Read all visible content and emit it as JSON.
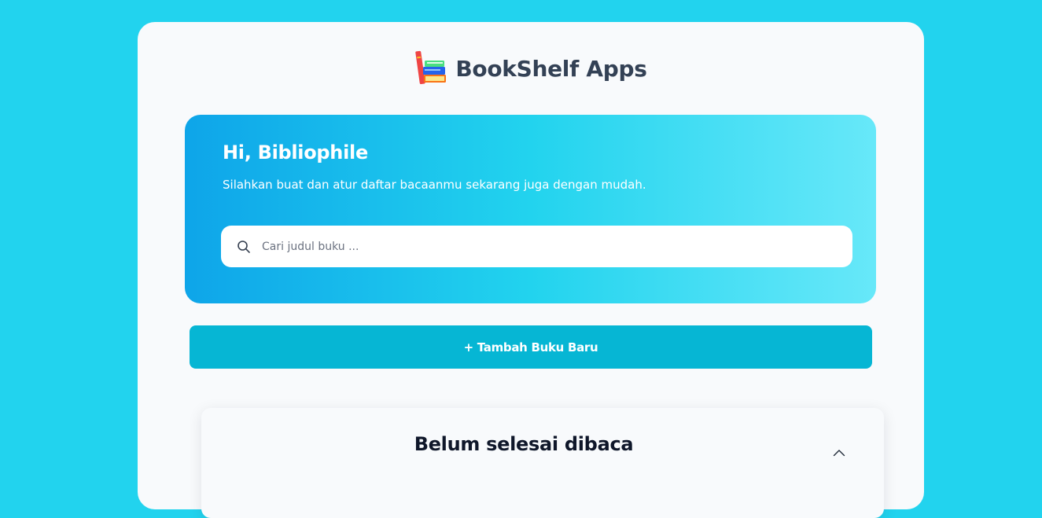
{
  "header": {
    "logo_icon": "books-stack-icon",
    "title": "BookShelf Apps"
  },
  "hero": {
    "greeting": "Hi, Bibliophile",
    "subtitle": "Silahkan buat dan atur daftar bacaanmu sekarang juga dengan mudah.",
    "gradient": [
      "#0ea5e9",
      "#22d3ee",
      "#67e8f9"
    ]
  },
  "search": {
    "icon": "search-icon",
    "placeholder": "Cari judul buku ...",
    "value": ""
  },
  "actions": {
    "add_book_label": "+ Tambah Buku Baru"
  },
  "section": {
    "title": "Belum selesai dibaca",
    "toggle_icon": "chevron-up-icon"
  },
  "colors": {
    "page_background": "#22d3ee",
    "card_background": "#f8fafc",
    "button": "#06b6d4",
    "title_text": "#334155"
  }
}
